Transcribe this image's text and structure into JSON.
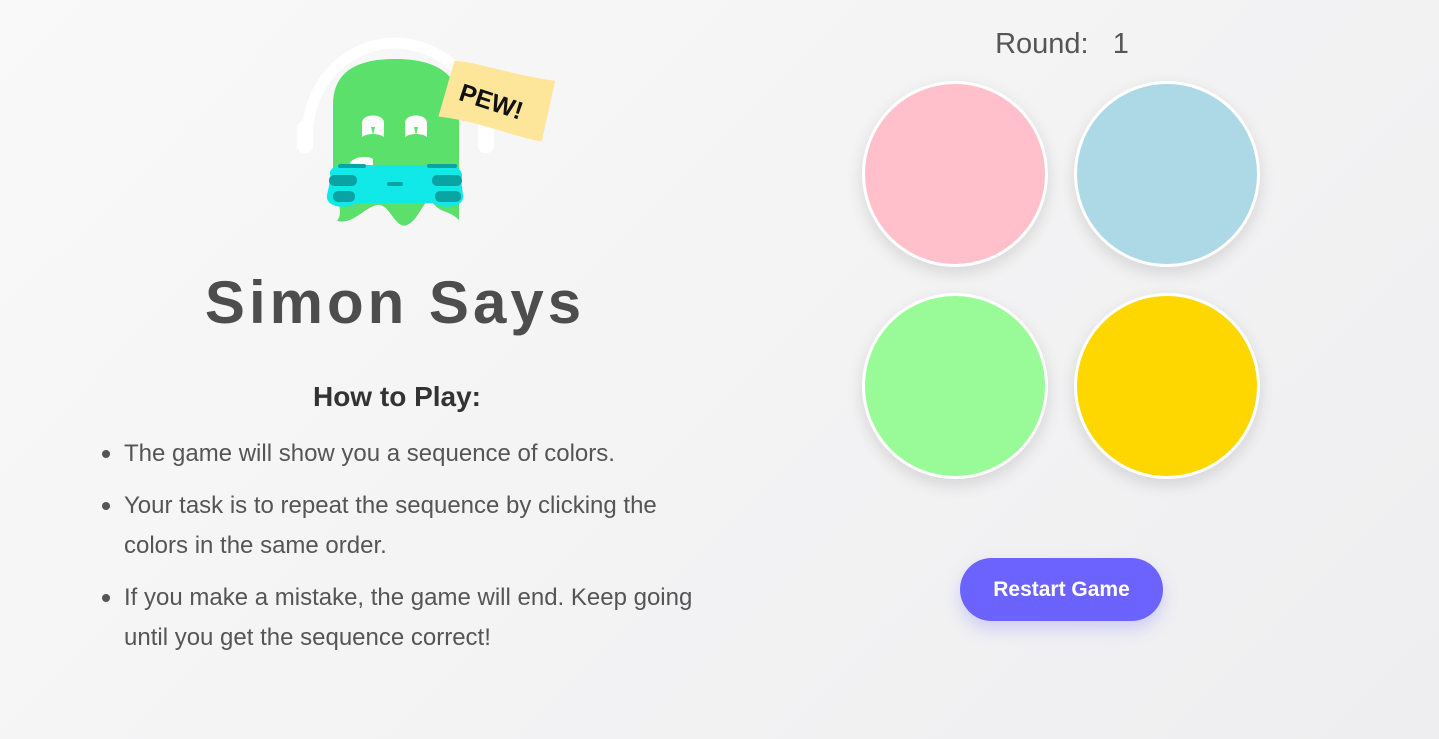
{
  "app": {
    "title": "Simon Says",
    "logo_sign_text": "PEW!"
  },
  "instructions": {
    "heading": "How to Play:",
    "items": [
      "The game will show you a sequence of colors.",
      "Your task is to repeat the sequence by clicking the colors in the same order.",
      "If you make a mistake, the game will end. Keep going until you get the sequence correct!"
    ]
  },
  "game": {
    "round_label": "Round:",
    "round_value": "1",
    "pads": [
      {
        "name": "pink",
        "color": "#ffc0cb"
      },
      {
        "name": "lightblue",
        "color": "#add8e6"
      },
      {
        "name": "lightgreen",
        "color": "#98fb98"
      },
      {
        "name": "yellow",
        "color": "#ffd700"
      }
    ],
    "restart_label": "Restart Game"
  },
  "colors": {
    "accent": "#6c63ff",
    "ghost_green": "#5ae06b",
    "controller_cyan": "#11e8e8",
    "sign_yellow": "#fde59a"
  },
  "icons": {
    "logo": "gamer-ghost-icon"
  }
}
